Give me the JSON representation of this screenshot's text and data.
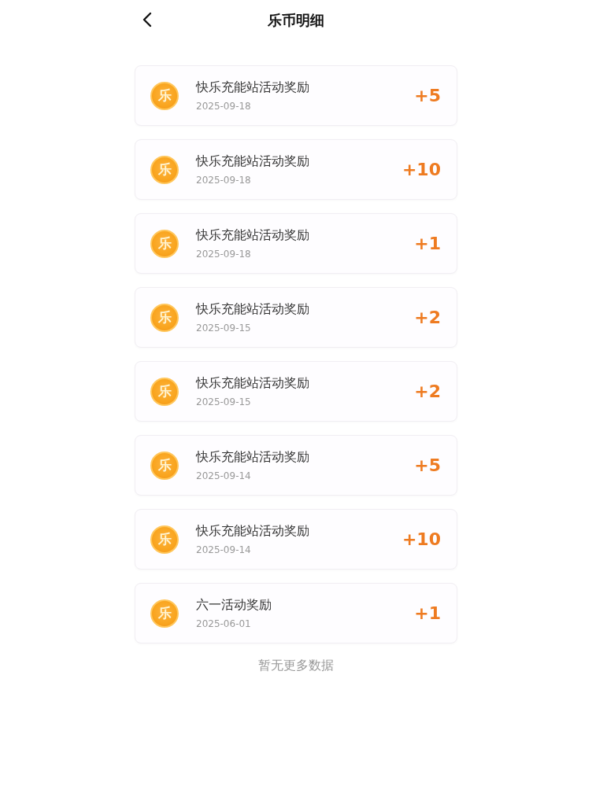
{
  "header": {
    "title": "乐币明细"
  },
  "records": [
    {
      "coin": "乐",
      "title": "快乐充能站活动奖励",
      "date": "2025-09-18",
      "amount": "+5"
    },
    {
      "coin": "乐",
      "title": "快乐充能站活动奖励",
      "date": "2025-09-18",
      "amount": "+10"
    },
    {
      "coin": "乐",
      "title": "快乐充能站活动奖励",
      "date": "2025-09-18",
      "amount": "+1"
    },
    {
      "coin": "乐",
      "title": "快乐充能站活动奖励",
      "date": "2025-09-15",
      "amount": "+2"
    },
    {
      "coin": "乐",
      "title": "快乐充能站活动奖励",
      "date": "2025-09-15",
      "amount": "+2"
    },
    {
      "coin": "乐",
      "title": "快乐充能站活动奖励",
      "date": "2025-09-14",
      "amount": "+5"
    },
    {
      "coin": "乐",
      "title": "快乐充能站活动奖励",
      "date": "2025-09-14",
      "amount": "+10"
    },
    {
      "coin": "乐",
      "title": "六一活动奖励",
      "date": "2025-06-01",
      "amount": "+1"
    }
  ],
  "footer": "暂无更多数据"
}
